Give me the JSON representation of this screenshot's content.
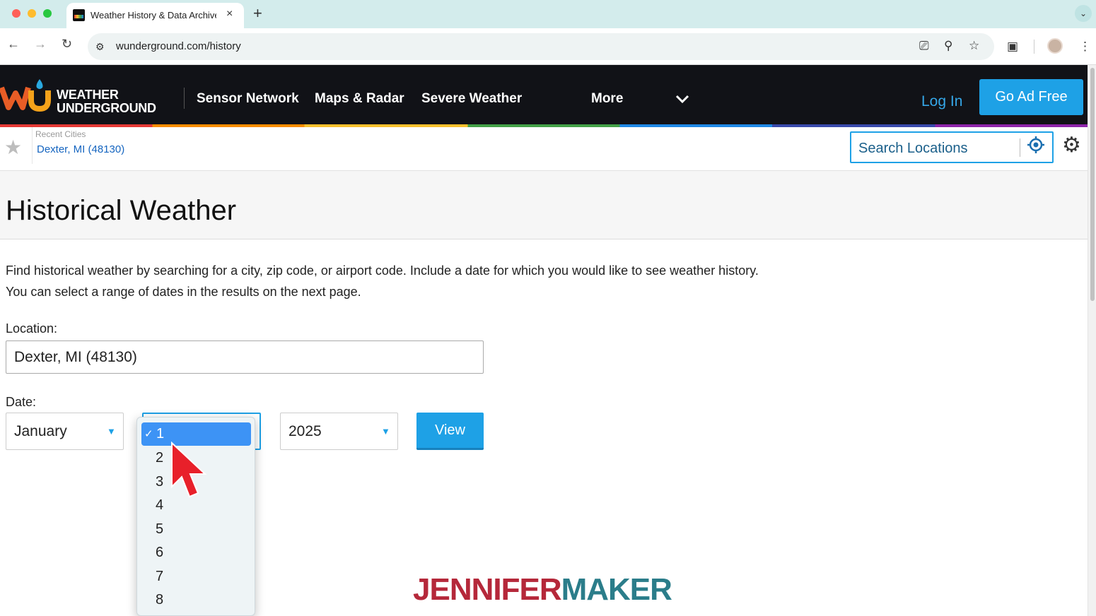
{
  "browser": {
    "tab_title": "Weather History & Data Archive",
    "url": "wunderground.com/history",
    "new_tab_label": "+",
    "tab_close_label": "×"
  },
  "header": {
    "logo_line1": "WEATHER",
    "logo_line2": "UNDERGROUND",
    "nav": [
      {
        "label": "Sensor Network"
      },
      {
        "label": "Maps & Radar"
      },
      {
        "label": "Severe Weather"
      },
      {
        "label": "More"
      }
    ],
    "login_label": "Log In",
    "go_ad_free_label": "Go Ad Free"
  },
  "subbar": {
    "recent_label": "Recent Cities",
    "recent_city": "Dexter, MI (48130)",
    "search_placeholder": "Search Locations"
  },
  "main": {
    "title": "Historical Weather",
    "description": "Find historical weather by searching for a city, zip code, or airport code. Include a date for which you would like to see weather history. You can select a range of dates in the results on the next page.",
    "location_label": "Location:",
    "location_value": "Dexter, MI (48130)",
    "date_label": "Date:",
    "month_value": "January",
    "year_value": "2025",
    "view_label": "View"
  },
  "day_dropdown": {
    "selected": "1",
    "options": [
      "1",
      "2",
      "3",
      "4",
      "5",
      "6",
      "7",
      "8"
    ]
  },
  "watermark": {
    "part1": "JENNIFER",
    "part2": "MAKER"
  },
  "colors": {
    "accent": "#1ea1e6",
    "header_bg": "#111217",
    "dropdown_selected": "#3d93f5",
    "brand_red": "#b5283a",
    "brand_teal": "#2b7d8a"
  }
}
